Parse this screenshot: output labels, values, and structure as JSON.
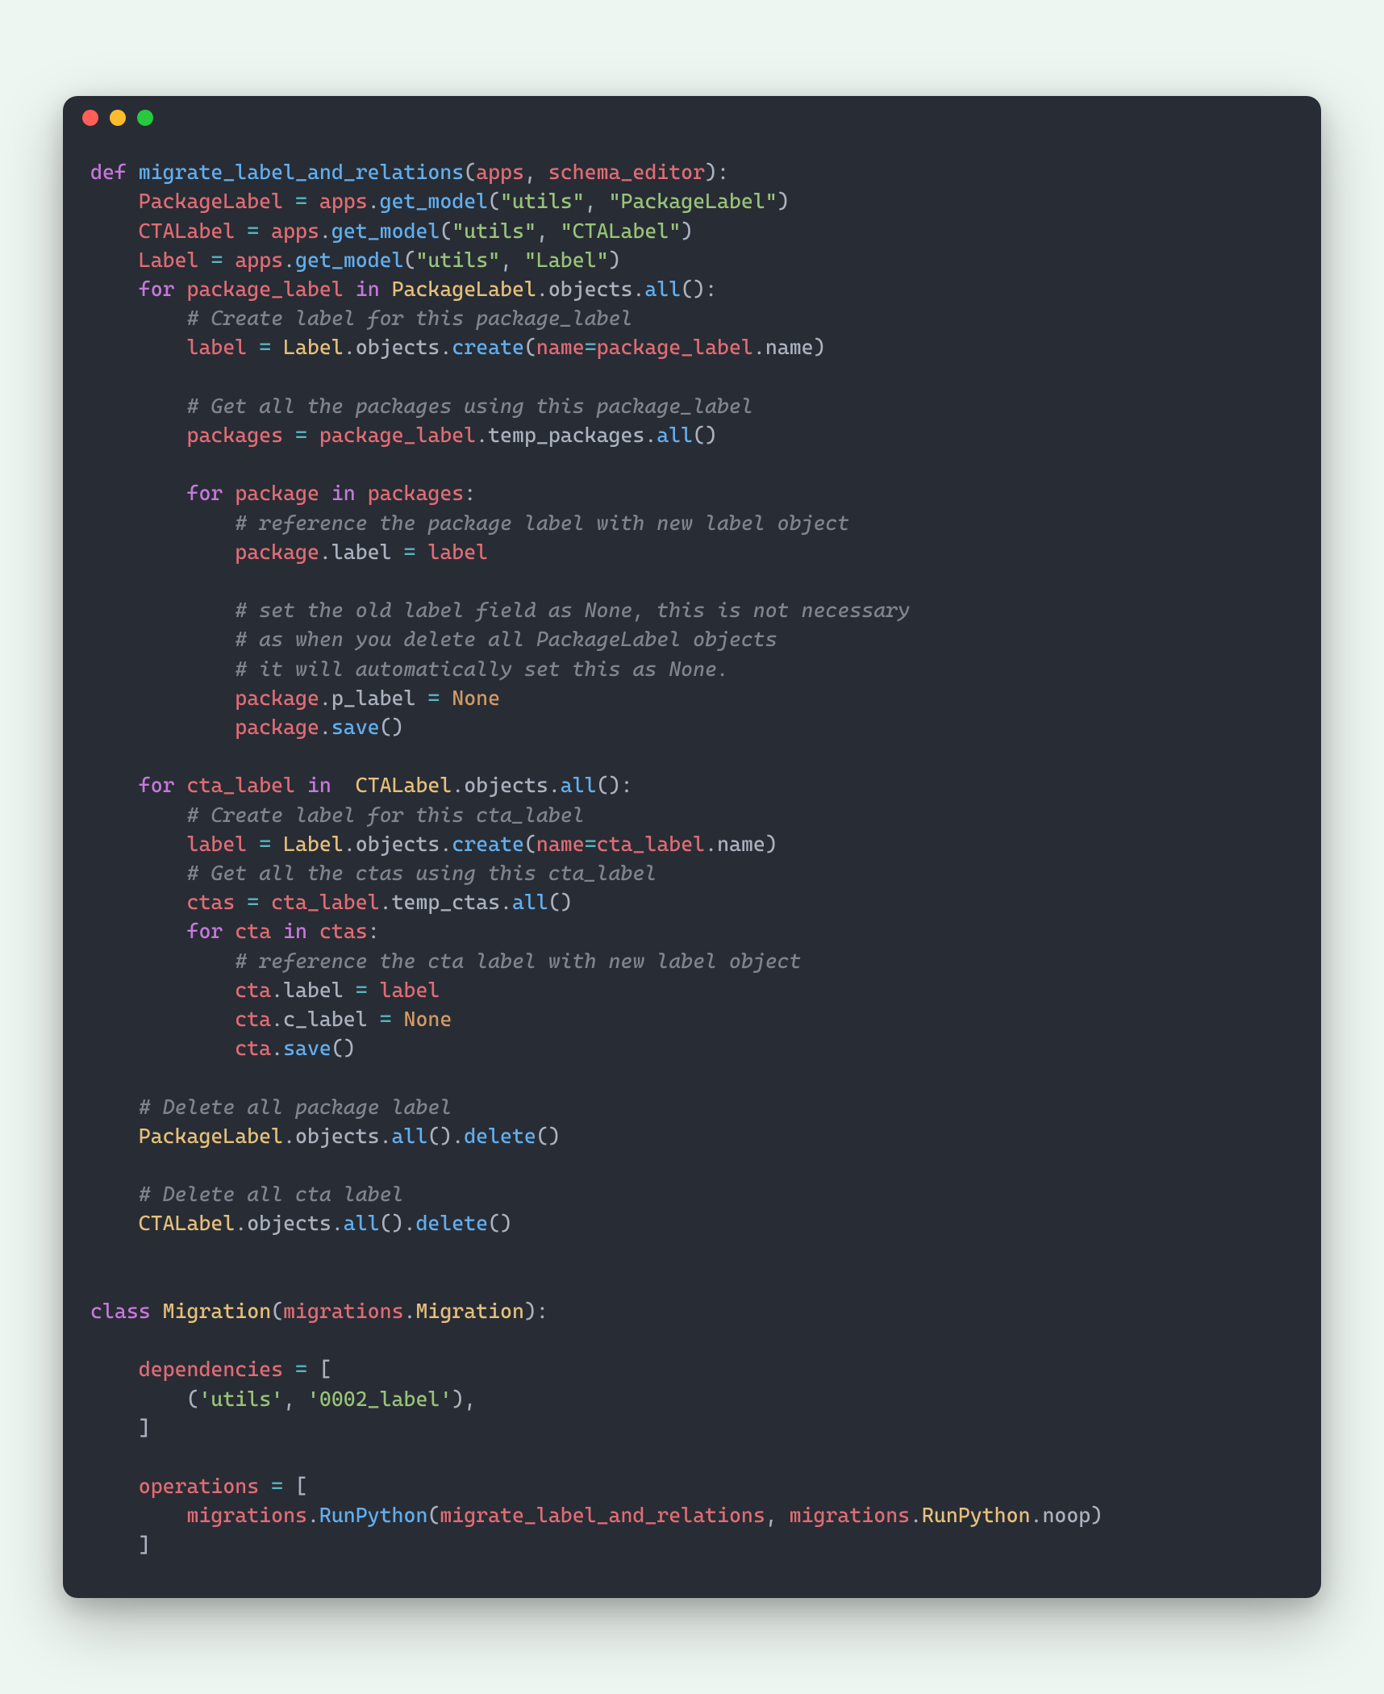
{
  "window": {
    "traffic_lights": [
      "red",
      "yellow",
      "green"
    ]
  },
  "code_tokens": [
    [
      [
        "kw",
        "def "
      ],
      [
        "fn",
        "migrate_label_and_relations"
      ],
      [
        "pun",
        "("
      ],
      [
        "var",
        "apps"
      ],
      [
        "pun",
        ", "
      ],
      [
        "var",
        "schema_editor"
      ],
      [
        "pun",
        "):"
      ]
    ],
    [
      [
        "pun",
        "    "
      ],
      [
        "var",
        "PackageLabel"
      ],
      [
        "pun",
        " "
      ],
      [
        "op",
        "="
      ],
      [
        "pun",
        " "
      ],
      [
        "var",
        "apps"
      ],
      [
        "pun",
        "."
      ],
      [
        "fn",
        "get_model"
      ],
      [
        "pun",
        "("
      ],
      [
        "str",
        "\"utils\""
      ],
      [
        "pun",
        ", "
      ],
      [
        "str",
        "\"PackageLabel\""
      ],
      [
        "pun",
        ")"
      ]
    ],
    [
      [
        "pun",
        "    "
      ],
      [
        "var",
        "CTALabel"
      ],
      [
        "pun",
        " "
      ],
      [
        "op",
        "="
      ],
      [
        "pun",
        " "
      ],
      [
        "var",
        "apps"
      ],
      [
        "pun",
        "."
      ],
      [
        "fn",
        "get_model"
      ],
      [
        "pun",
        "("
      ],
      [
        "str",
        "\"utils\""
      ],
      [
        "pun",
        ", "
      ],
      [
        "str",
        "\"CTALabel\""
      ],
      [
        "pun",
        ")"
      ]
    ],
    [
      [
        "pun",
        "    "
      ],
      [
        "var",
        "Label"
      ],
      [
        "pun",
        " "
      ],
      [
        "op",
        "="
      ],
      [
        "pun",
        " "
      ],
      [
        "var",
        "apps"
      ],
      [
        "pun",
        "."
      ],
      [
        "fn",
        "get_model"
      ],
      [
        "pun",
        "("
      ],
      [
        "str",
        "\"utils\""
      ],
      [
        "pun",
        ", "
      ],
      [
        "str",
        "\"Label\""
      ],
      [
        "pun",
        ")"
      ]
    ],
    [
      [
        "pun",
        "    "
      ],
      [
        "kw",
        "for"
      ],
      [
        "pun",
        " "
      ],
      [
        "var",
        "package_label"
      ],
      [
        "pun",
        " "
      ],
      [
        "kw",
        "in"
      ],
      [
        "pun",
        " "
      ],
      [
        "cls",
        "PackageLabel"
      ],
      [
        "pun",
        ".objects."
      ],
      [
        "fn",
        "all"
      ],
      [
        "pun",
        "():"
      ]
    ],
    [
      [
        "pun",
        "        "
      ],
      [
        "com",
        "# Create label for this package_label"
      ]
    ],
    [
      [
        "pun",
        "        "
      ],
      [
        "var",
        "label"
      ],
      [
        "pun",
        " "
      ],
      [
        "op",
        "="
      ],
      [
        "pun",
        " "
      ],
      [
        "cls",
        "Label"
      ],
      [
        "pun",
        ".objects."
      ],
      [
        "fn",
        "create"
      ],
      [
        "pun",
        "("
      ],
      [
        "var",
        "name"
      ],
      [
        "op",
        "="
      ],
      [
        "var",
        "package_label"
      ],
      [
        "pun",
        ".name)"
      ]
    ],
    [
      [
        "pun",
        ""
      ]
    ],
    [
      [
        "pun",
        "        "
      ],
      [
        "com",
        "# Get all the packages using this package_label"
      ]
    ],
    [
      [
        "pun",
        "        "
      ],
      [
        "var",
        "packages"
      ],
      [
        "pun",
        " "
      ],
      [
        "op",
        "="
      ],
      [
        "pun",
        " "
      ],
      [
        "var",
        "package_label"
      ],
      [
        "pun",
        ".temp_packages."
      ],
      [
        "fn",
        "all"
      ],
      [
        "pun",
        "()"
      ]
    ],
    [
      [
        "pun",
        ""
      ]
    ],
    [
      [
        "pun",
        "        "
      ],
      [
        "kw",
        "for"
      ],
      [
        "pun",
        " "
      ],
      [
        "var",
        "package"
      ],
      [
        "pun",
        " "
      ],
      [
        "kw",
        "in"
      ],
      [
        "pun",
        " "
      ],
      [
        "var",
        "packages"
      ],
      [
        "pun",
        ":"
      ]
    ],
    [
      [
        "pun",
        "            "
      ],
      [
        "com",
        "# reference the package label with new label object"
      ]
    ],
    [
      [
        "pun",
        "            "
      ],
      [
        "var",
        "package"
      ],
      [
        "pun",
        ".label "
      ],
      [
        "op",
        "="
      ],
      [
        "pun",
        " "
      ],
      [
        "var",
        "label"
      ]
    ],
    [
      [
        "pun",
        ""
      ]
    ],
    [
      [
        "pun",
        "            "
      ],
      [
        "com",
        "# set the old label field as None, this is not necessary"
      ]
    ],
    [
      [
        "pun",
        "            "
      ],
      [
        "com",
        "# as when you delete all PackageLabel objects"
      ]
    ],
    [
      [
        "pun",
        "            "
      ],
      [
        "com",
        "# it will automatically set this as None."
      ]
    ],
    [
      [
        "pun",
        "            "
      ],
      [
        "var",
        "package"
      ],
      [
        "pun",
        ".p_label "
      ],
      [
        "op",
        "="
      ],
      [
        "pun",
        " "
      ],
      [
        "none",
        "None"
      ]
    ],
    [
      [
        "pun",
        "            "
      ],
      [
        "var",
        "package"
      ],
      [
        "pun",
        "."
      ],
      [
        "fn",
        "save"
      ],
      [
        "pun",
        "()"
      ]
    ],
    [
      [
        "pun",
        ""
      ]
    ],
    [
      [
        "pun",
        "    "
      ],
      [
        "kw",
        "for"
      ],
      [
        "pun",
        " "
      ],
      [
        "var",
        "cta_label"
      ],
      [
        "pun",
        " "
      ],
      [
        "kw",
        "in"
      ],
      [
        "pun",
        "  "
      ],
      [
        "cls",
        "CTALabel"
      ],
      [
        "pun",
        ".objects."
      ],
      [
        "fn",
        "all"
      ],
      [
        "pun",
        "():"
      ]
    ],
    [
      [
        "pun",
        "        "
      ],
      [
        "com",
        "# Create label for this cta_label"
      ]
    ],
    [
      [
        "pun",
        "        "
      ],
      [
        "var",
        "label"
      ],
      [
        "pun",
        " "
      ],
      [
        "op",
        "="
      ],
      [
        "pun",
        " "
      ],
      [
        "cls",
        "Label"
      ],
      [
        "pun",
        ".objects."
      ],
      [
        "fn",
        "create"
      ],
      [
        "pun",
        "("
      ],
      [
        "var",
        "name"
      ],
      [
        "op",
        "="
      ],
      [
        "var",
        "cta_label"
      ],
      [
        "pun",
        ".name)"
      ]
    ],
    [
      [
        "pun",
        "        "
      ],
      [
        "com",
        "# Get all the ctas using this cta_label"
      ]
    ],
    [
      [
        "pun",
        "        "
      ],
      [
        "var",
        "ctas"
      ],
      [
        "pun",
        " "
      ],
      [
        "op",
        "="
      ],
      [
        "pun",
        " "
      ],
      [
        "var",
        "cta_label"
      ],
      [
        "pun",
        ".temp_ctas."
      ],
      [
        "fn",
        "all"
      ],
      [
        "pun",
        "()"
      ]
    ],
    [
      [
        "pun",
        "        "
      ],
      [
        "kw",
        "for"
      ],
      [
        "pun",
        " "
      ],
      [
        "var",
        "cta"
      ],
      [
        "pun",
        " "
      ],
      [
        "kw",
        "in"
      ],
      [
        "pun",
        " "
      ],
      [
        "var",
        "ctas"
      ],
      [
        "pun",
        ":"
      ]
    ],
    [
      [
        "pun",
        "            "
      ],
      [
        "com",
        "# reference the cta label with new label object"
      ]
    ],
    [
      [
        "pun",
        "            "
      ],
      [
        "var",
        "cta"
      ],
      [
        "pun",
        ".label "
      ],
      [
        "op",
        "="
      ],
      [
        "pun",
        " "
      ],
      [
        "var",
        "label"
      ]
    ],
    [
      [
        "pun",
        "            "
      ],
      [
        "var",
        "cta"
      ],
      [
        "pun",
        ".c_label "
      ],
      [
        "op",
        "="
      ],
      [
        "pun",
        " "
      ],
      [
        "none",
        "None"
      ]
    ],
    [
      [
        "pun",
        "            "
      ],
      [
        "var",
        "cta"
      ],
      [
        "pun",
        "."
      ],
      [
        "fn",
        "save"
      ],
      [
        "pun",
        "()"
      ]
    ],
    [
      [
        "pun",
        ""
      ]
    ],
    [
      [
        "pun",
        "    "
      ],
      [
        "com",
        "# Delete all package label"
      ]
    ],
    [
      [
        "pun",
        "    "
      ],
      [
        "cls",
        "PackageLabel"
      ],
      [
        "pun",
        ".objects."
      ],
      [
        "fn",
        "all"
      ],
      [
        "pun",
        "()."
      ],
      [
        "fn",
        "delete"
      ],
      [
        "pun",
        "()"
      ]
    ],
    [
      [
        "pun",
        ""
      ]
    ],
    [
      [
        "pun",
        "    "
      ],
      [
        "com",
        "# Delete all cta label"
      ]
    ],
    [
      [
        "pun",
        "    "
      ],
      [
        "cls",
        "CTALabel"
      ],
      [
        "pun",
        ".objects."
      ],
      [
        "fn",
        "all"
      ],
      [
        "pun",
        "()."
      ],
      [
        "fn",
        "delete"
      ],
      [
        "pun",
        "()"
      ]
    ],
    [
      [
        "pun",
        ""
      ]
    ],
    [
      [
        "pun",
        ""
      ]
    ],
    [
      [
        "kw",
        "class "
      ],
      [
        "cls",
        "Migration"
      ],
      [
        "pun",
        "("
      ],
      [
        "var",
        "migrations"
      ],
      [
        "pun",
        "."
      ],
      [
        "cls",
        "Migration"
      ],
      [
        "pun",
        "):"
      ]
    ],
    [
      [
        "pun",
        ""
      ]
    ],
    [
      [
        "pun",
        "    "
      ],
      [
        "var",
        "dependencies"
      ],
      [
        "pun",
        " "
      ],
      [
        "op",
        "="
      ],
      [
        "pun",
        " ["
      ]
    ],
    [
      [
        "pun",
        "        ("
      ],
      [
        "str",
        "'utils'"
      ],
      [
        "pun",
        ", "
      ],
      [
        "str",
        "'0002_label'"
      ],
      [
        "pun",
        "),"
      ]
    ],
    [
      [
        "pun",
        "    ]"
      ]
    ],
    [
      [
        "pun",
        ""
      ]
    ],
    [
      [
        "pun",
        "    "
      ],
      [
        "var",
        "operations"
      ],
      [
        "pun",
        " "
      ],
      [
        "op",
        "="
      ],
      [
        "pun",
        " ["
      ]
    ],
    [
      [
        "pun",
        "        "
      ],
      [
        "var",
        "migrations"
      ],
      [
        "pun",
        "."
      ],
      [
        "fn",
        "RunPython"
      ],
      [
        "pun",
        "("
      ],
      [
        "var",
        "migrate_label_and_relations"
      ],
      [
        "pun",
        ", "
      ],
      [
        "var",
        "migrations"
      ],
      [
        "pun",
        "."
      ],
      [
        "cls",
        "RunPython"
      ],
      [
        "pun",
        ".noop)"
      ]
    ],
    [
      [
        "pun",
        "    ]"
      ]
    ]
  ]
}
